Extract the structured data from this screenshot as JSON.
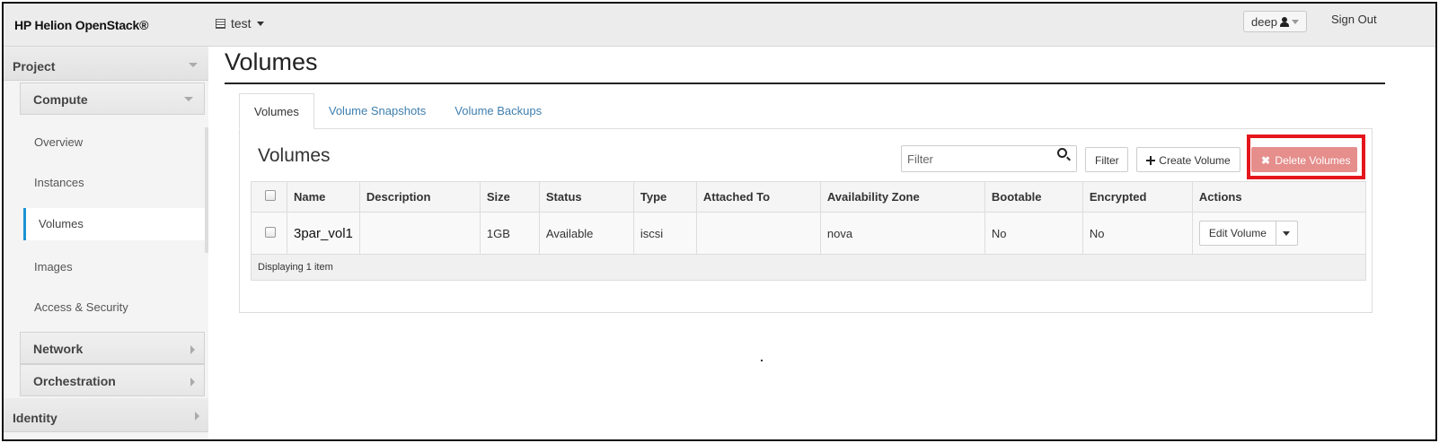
{
  "header": {
    "brand": "HP Helion OpenStack®",
    "project": "test",
    "user": "deep",
    "sign_out": "Sign Out"
  },
  "sidebar": {
    "project": "Project",
    "compute": "Compute",
    "items": [
      "Overview",
      "Instances",
      "Volumes",
      "Images",
      "Access & Security"
    ],
    "active_item": "Volumes",
    "network": "Network",
    "orchestration": "Orchestration",
    "identity": "Identity"
  },
  "main": {
    "page_title": "Volumes",
    "tabs": [
      {
        "label": "Volumes",
        "active": true
      },
      {
        "label": "Volume Snapshots",
        "active": false
      },
      {
        "label": "Volume Backups",
        "active": false
      }
    ],
    "panel_title": "Volumes",
    "filter_placeholder": "Filter",
    "filter_button": "Filter",
    "create_button": "Create Volume",
    "delete_button": "Delete Volumes",
    "table": {
      "columns": [
        "Name",
        "Description",
        "Size",
        "Status",
        "Type",
        "Attached To",
        "Availability Zone",
        "Bootable",
        "Encrypted",
        "Actions"
      ],
      "rows": [
        {
          "name": "3par_vol1",
          "description": "",
          "size": "1GB",
          "status": "Available",
          "type": "iscsi",
          "attached_to": "",
          "zone": "nova",
          "bootable": "No",
          "encrypted": "No",
          "action": "Edit Volume"
        }
      ],
      "footer": "Displaying 1 item"
    }
  },
  "colors": {
    "accent_active": "#1a93d1",
    "link": "#3f7fae",
    "delete_button": "#e58e8c",
    "highlight_box": "#e4161c"
  },
  "icons": [
    "project-list-icon",
    "user-icon",
    "search-icon",
    "plus-icon",
    "close-icon",
    "chevron-down-icon",
    "chevron-right-icon"
  ]
}
